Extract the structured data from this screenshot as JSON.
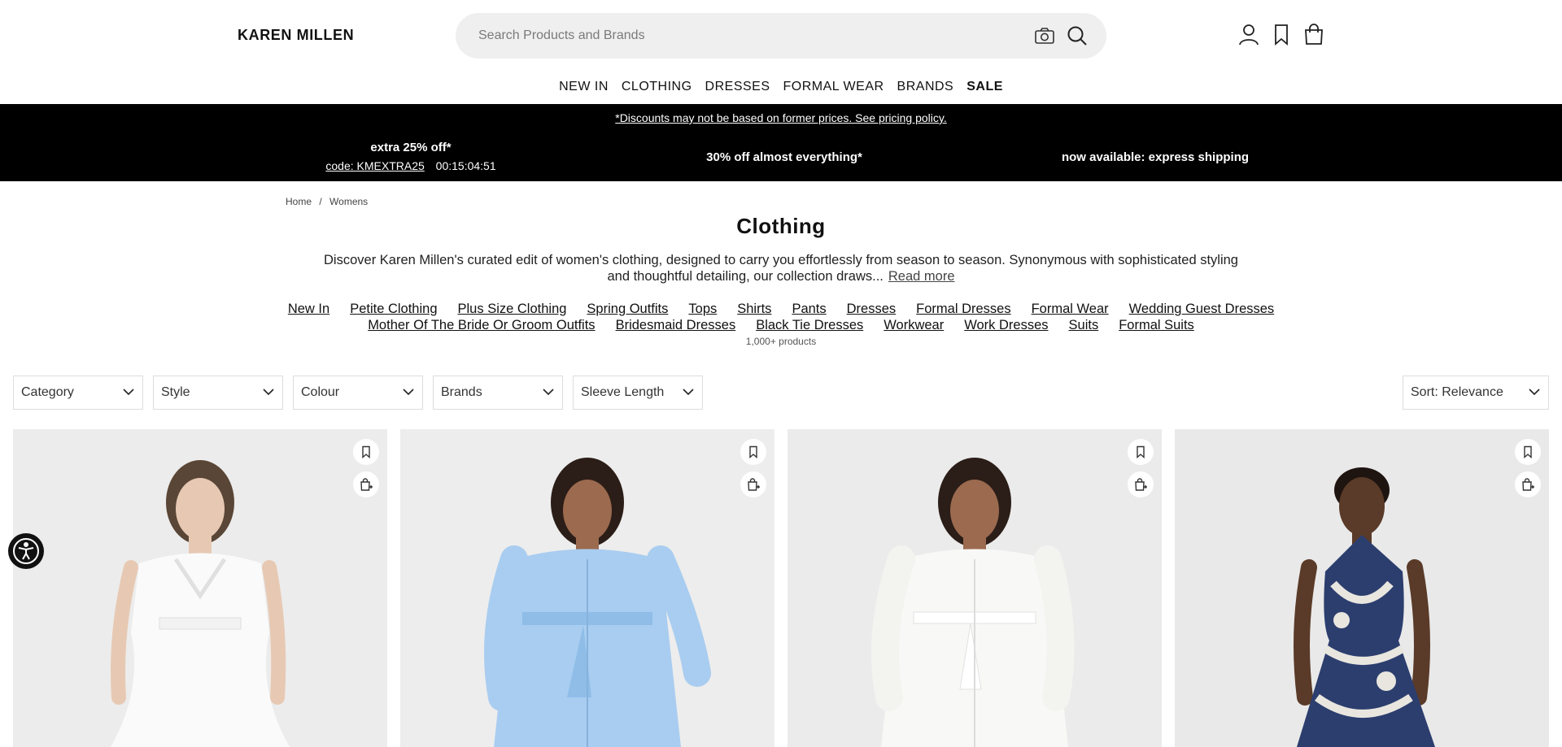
{
  "header": {
    "logo": "KAREN MILLEN",
    "search_placeholder": "Search Products and Brands",
    "icons": [
      "camera-icon",
      "search-icon",
      "account-icon",
      "wishlist-icon",
      "bag-icon"
    ]
  },
  "nav": {
    "items": [
      "NEW IN",
      "CLOTHING",
      "DRESSES",
      "FORMAL WEAR",
      "BRANDS"
    ],
    "sale": "SALE"
  },
  "promo": {
    "disclaimer": "*Discounts may not be based on former prices. See pricing policy.",
    "offer1_title": "extra 25% off*",
    "offer1_code": "code: KMEXTRA25",
    "offer1_timer": "00:15:04:51",
    "offer2": "30% off almost everything*",
    "offer3": "now available: express shipping"
  },
  "breadcrumb": {
    "home": "Home",
    "sep": "/",
    "current": "Womens"
  },
  "page": {
    "title": "Clothing",
    "description": "Discover Karen Millen's curated edit of women's clothing, designed to carry you effortlessly from season to season. Synonymous with sophisticated styling and thoughtful detailing, our collection draws...",
    "read_more": "Read more",
    "count": "1,000+ products"
  },
  "categories": {
    "row1": [
      "New In",
      "Petite Clothing",
      "Plus Size Clothing",
      "Spring Outfits",
      "Tops",
      "Shirts",
      "Pants",
      "Dresses",
      "Formal Dresses",
      "Formal Wear",
      "Wedding Guest Dresses"
    ],
    "row2": [
      "Mother Of The Bride Or Groom Outfits",
      "Bridesmaid Dresses",
      "Black Tie Dresses",
      "Workwear",
      "Work Dresses",
      "Suits",
      "Formal Suits"
    ]
  },
  "filters": {
    "category": "Category",
    "style": "Style",
    "colour": "Colour",
    "brands": "Brands",
    "sleeve": "Sleeve Length",
    "sort": "Sort: Relevance"
  },
  "colors": {
    "promo_bg": "#000000",
    "search_bg": "#efefef",
    "product_bg": "#eeeeee"
  }
}
